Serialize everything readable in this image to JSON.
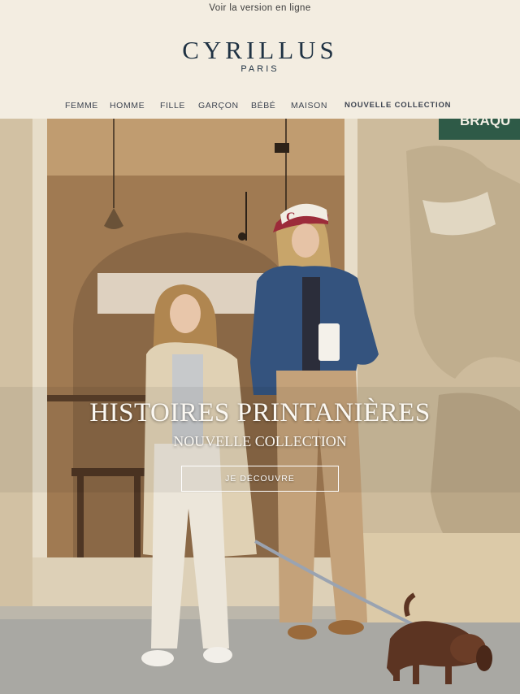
{
  "topbar": {
    "view_online": "Voir la version en ligne"
  },
  "brand": {
    "name": "CYRILLUS",
    "city": "PARIS"
  },
  "nav": {
    "items": [
      "FEMME",
      "HOMME",
      "FILLE",
      "GARÇON",
      "BÉBÉ",
      "MAISON",
      "NOUVELLE COLLECTION"
    ]
  },
  "hero": {
    "title": "HISTOIRES PRINTANIÈRES",
    "subtitle": "NOUVELLE COLLECTION",
    "cta": "JE DÉCOUVRE",
    "cap_letter": "C",
    "street_sign": "BRAQU"
  },
  "colors": {
    "background": "#f3ede1",
    "brand_navy": "#1f3243",
    "nav_text": "#3d4450"
  }
}
